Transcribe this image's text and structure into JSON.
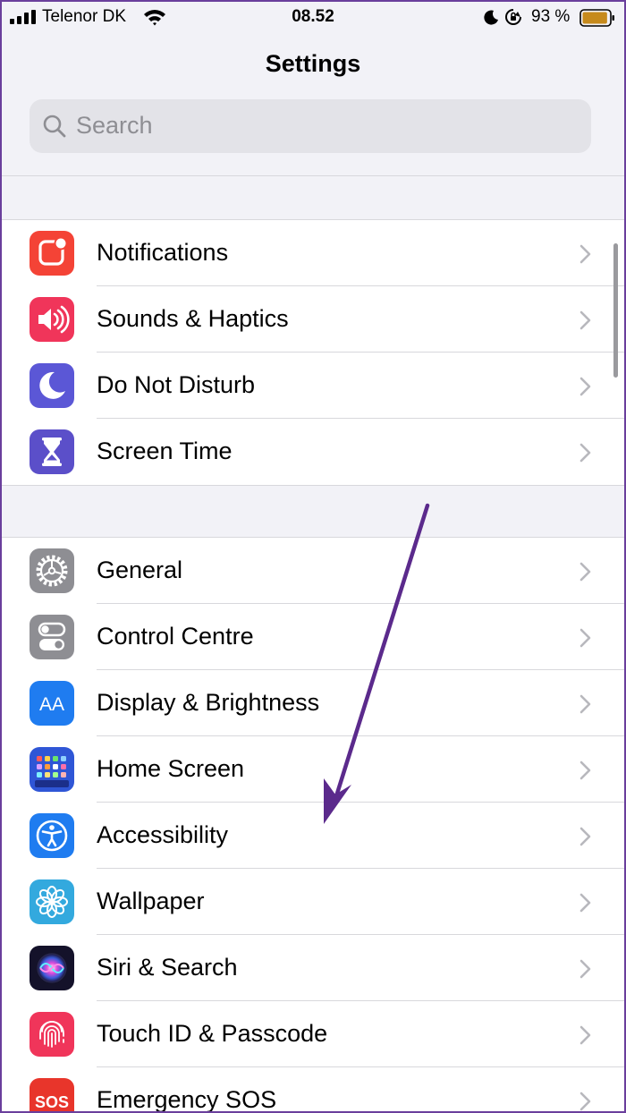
{
  "status_bar": {
    "carrier": "Telenor DK",
    "time": "08.52",
    "battery_percent": "93 %",
    "battery_level": 0.93
  },
  "header": {
    "title": "Settings"
  },
  "search": {
    "placeholder": "Search"
  },
  "colors": {
    "accent_arrow": "#5b2a8c",
    "notifications": "#f44336",
    "sounds": "#f0355a",
    "do_not_disturb": "#5b57d6",
    "screen_time": "#5b4fc9",
    "general": "#8e8e93",
    "control_centre": "#8e8e93",
    "display": "#1f7cf0",
    "home_screen": "#2f56d6",
    "accessibility": "#1f7cf0",
    "wallpaper": "#33a9de",
    "touch_id": "#f0355a",
    "emergency_sos": "#e8352b"
  },
  "groups": [
    {
      "items": [
        {
          "label": "Notifications",
          "icon": "notifications-icon"
        },
        {
          "label": "Sounds & Haptics",
          "icon": "speaker-icon"
        },
        {
          "label": "Do Not Disturb",
          "icon": "moon-icon"
        },
        {
          "label": "Screen Time",
          "icon": "hourglass-icon"
        }
      ]
    },
    {
      "items": [
        {
          "label": "General",
          "icon": "gear-icon"
        },
        {
          "label": "Control Centre",
          "icon": "toggles-icon"
        },
        {
          "label": "Display & Brightness",
          "icon": "text-size-icon",
          "icon_text": "AA"
        },
        {
          "label": "Home Screen",
          "icon": "app-grid-icon"
        },
        {
          "label": "Accessibility",
          "icon": "accessibility-icon"
        },
        {
          "label": "Wallpaper",
          "icon": "flower-icon"
        },
        {
          "label": "Siri & Search",
          "icon": "siri-icon"
        },
        {
          "label": "Touch ID & Passcode",
          "icon": "fingerprint-icon"
        },
        {
          "label": "Emergency SOS",
          "icon": "sos-icon",
          "icon_text": "SOS"
        }
      ]
    }
  ]
}
